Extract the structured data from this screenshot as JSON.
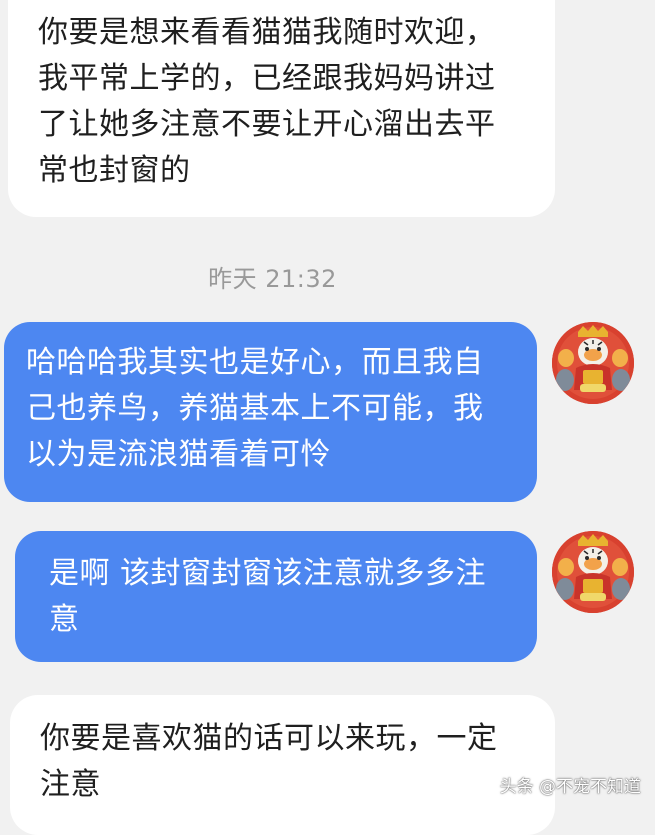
{
  "messages": [
    {
      "side": "incoming",
      "lines": [
        "你要是想来看看猫猫我随时欢迎，",
        "我平常上学的，已经跟我妈妈讲过",
        "了让她多注意不要让开心溜出去平",
        "常也封窗的"
      ]
    },
    {
      "side": "outgoing",
      "lines": [
        "哈哈哈我其实也是好心，而且我自",
        "己也养鸟，养猫基本上不可能，我",
        "以为是流浪猫看着可怜"
      ]
    },
    {
      "side": "outgoing",
      "lines": [
        "是啊 该封窗封窗该注意就多多注",
        "意"
      ]
    },
    {
      "side": "incoming",
      "lines": [
        "你要是喜欢猫的话可以来玩，一定",
        "注意"
      ]
    }
  ],
  "timestamp": "昨天 21:32",
  "watermark": "头条 @不宠不知道",
  "avatar": {
    "icon": "tiger-god-of-wealth-avatar"
  },
  "colors": {
    "background": "#f1f1f1",
    "incoming_bubble": "#ffffff",
    "outgoing_bubble": "#4d87f1",
    "timestamp_text": "#999999"
  }
}
